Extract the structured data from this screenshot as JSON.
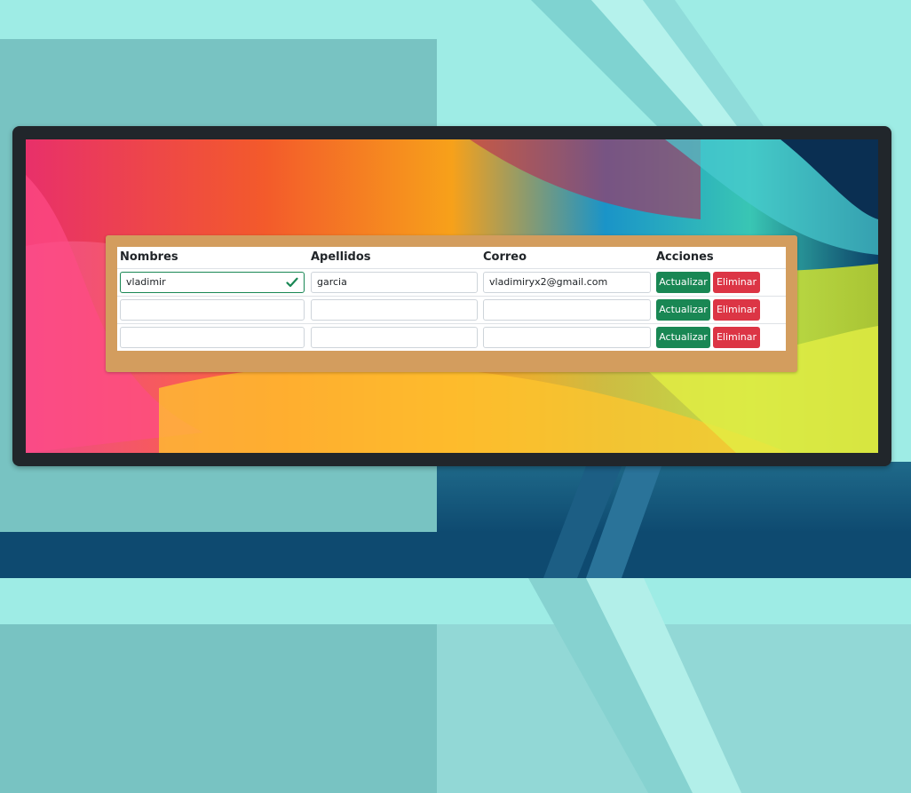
{
  "table": {
    "headers": {
      "nombres": "Nombres",
      "apellidos": "Apellidos",
      "correo": "Correo",
      "acciones": "Acciones"
    },
    "rows": [
      {
        "nombres": "vladimir",
        "apellidos": "garcia",
        "correo": "vladimiryx2@gmail.com",
        "nombres_valid": true
      },
      {
        "nombres": "",
        "apellidos": "",
        "correo": ""
      },
      {
        "nombres": "",
        "apellidos": "",
        "correo": ""
      }
    ],
    "actions": {
      "update_label": "Actualizar",
      "delete_label": "Eliminar"
    }
  },
  "colors": {
    "update_button": "#198754",
    "delete_button": "#dc3545",
    "card_background": "#d39d5e",
    "frame": "#21262b",
    "page_background": "#78c3c2",
    "valid_border": "#198754"
  },
  "icons": {
    "valid_indicator": "check-icon"
  }
}
